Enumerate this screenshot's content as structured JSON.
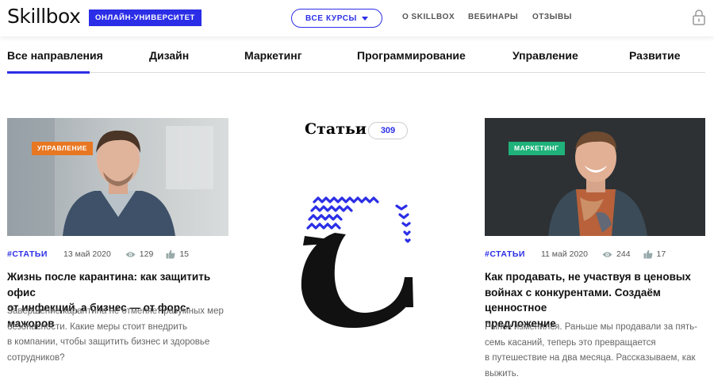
{
  "header": {
    "logo": "Skillbox",
    "badge": "ОНЛАЙН-УНИВЕРСИТЕТ",
    "courses_button": "ВСЕ КУРСЫ",
    "links": [
      "О SKILLBOX",
      "ВЕБИНАРЫ",
      "ОТЗЫВЫ"
    ],
    "lock_icon": "lock-icon"
  },
  "nav": {
    "categories": [
      "Все направления",
      "Дизайн",
      "Маркетинг",
      "Программирование",
      "Управление",
      "Развитие"
    ],
    "active": "Все направления"
  },
  "middle": {
    "heading": "Статьи",
    "count": "309"
  },
  "articles": [
    {
      "tag": "УПРАВЛЕНИЕ",
      "tag_color": "#e87722",
      "hashtag": "#СТАТЬИ",
      "date": "13 май 2020",
      "views": "129",
      "likes": "15",
      "title_lines": [
        "Жизнь после карантина: как защитить офис",
        "от инфекций, а бизнес — от форс-мажоров"
      ],
      "excerpt_lines": [
        "Завершение карантина не отменяет разумных мер",
        "безопасности. Какие меры стоит внедрить",
        "в компании, чтобы защитить бизнес и здоровье",
        "сотрудников?"
      ]
    },
    {
      "tag": "МАРКЕТИНГ",
      "tag_color": "#1fb27a",
      "hashtag": "#СТАТЬИ",
      "date": "11 май 2020",
      "views": "244",
      "likes": "17",
      "title_lines": [
        "Как продавать, не участвуя в ценовых",
        "войнах с конкурентами. Создаём ценностное",
        "предложение"
      ],
      "excerpt_lines": [
        "Рынок изменился. Раньше мы продавали за пять-",
        "семь касаний, теперь это превращается",
        "в путешествие на два месяца. Рассказываем, как",
        "выжить."
      ]
    }
  ],
  "colors": {
    "accent": "#2b2ee6"
  }
}
